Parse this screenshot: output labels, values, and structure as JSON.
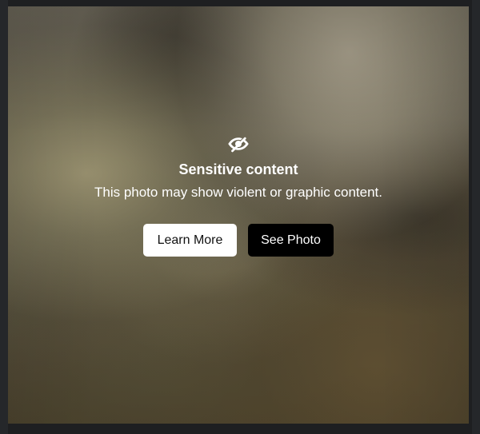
{
  "sensitive_view": {
    "icon": "eye-slash-icon",
    "title": "Sensitive content",
    "message": "This photo may show violent or graphic content.",
    "buttons": {
      "learn_more": "Learn More",
      "see_photo": "See Photo"
    },
    "colors": {
      "text": "#ffffff",
      "learn_more_bg": "#ffffff",
      "learn_more_text": "#111111",
      "see_photo_bg": "#000000",
      "see_photo_text": "#ffffff"
    }
  }
}
